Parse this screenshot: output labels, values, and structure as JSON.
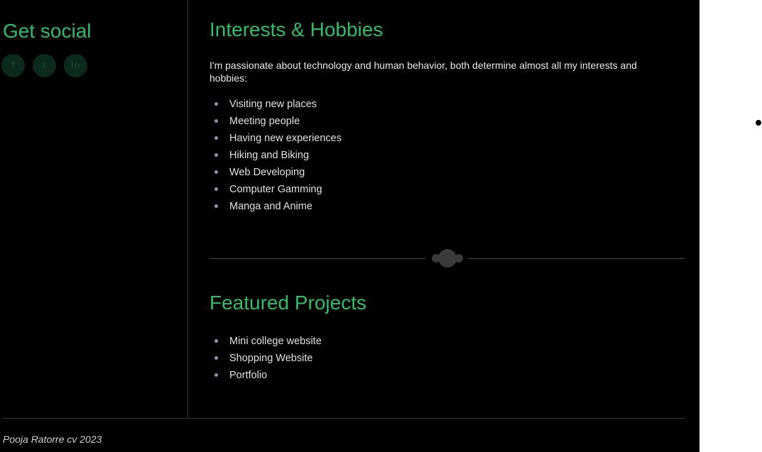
{
  "sidebar": {
    "title": "Get social",
    "social": [
      {
        "icon": "facebook-icon",
        "glyph": "f"
      },
      {
        "icon": "twitter-icon",
        "glyph": "t"
      },
      {
        "icon": "linkedin-icon",
        "glyph": "in"
      }
    ]
  },
  "interests": {
    "title": "Interests & Hobbies",
    "intro": "I'm passionate about technology and human behavior, both determine almost all my interests and hobbies:",
    "items": [
      "Visiting new places",
      "Meeting people",
      "Having new experiences",
      "Hiking and Biking",
      "Web Developing",
      "Computer Gamming",
      "Manga and Anime"
    ]
  },
  "projects": {
    "title": "Featured Projects",
    "items": [
      "Mini college website",
      "Shopping Website",
      "Portfolio"
    ]
  },
  "footer": {
    "text": "Pooja Ratorre cv 2023"
  },
  "colors": {
    "accent": "#2fbd6a",
    "background": "#000000",
    "bullet": "#9a8fb0"
  }
}
